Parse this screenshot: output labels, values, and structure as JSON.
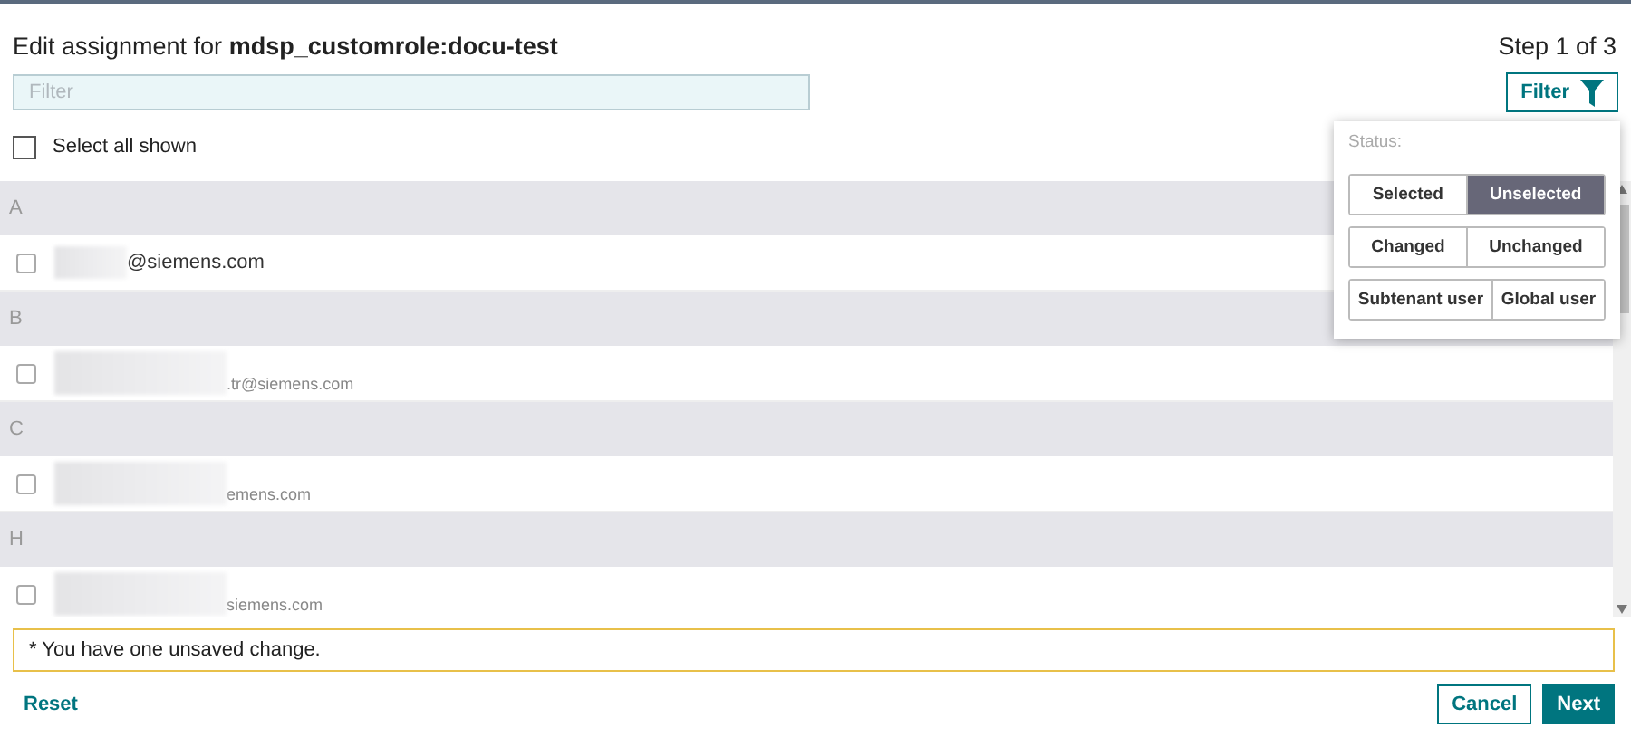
{
  "header": {
    "title_prefix": "Edit assignment for",
    "title_role": "mdsp_customrole:docu-test",
    "step": "Step 1 of 3"
  },
  "filter_field": {
    "placeholder": "Filter"
  },
  "filter_button": {
    "label": "Filter"
  },
  "select_all": {
    "label": "Select all shown",
    "checked": false
  },
  "groups": [
    {
      "letter": "A",
      "rows": [
        {
          "email": "@siemens.com",
          "kind": "primary",
          "checked": false
        }
      ]
    },
    {
      "letter": "B",
      "rows": [
        {
          "email": ".tr@siemens.com",
          "kind": "secondary",
          "checked": false
        }
      ]
    },
    {
      "letter": "C",
      "rows": [
        {
          "email": "emens.com",
          "kind": "secondary",
          "checked": false
        }
      ]
    },
    {
      "letter": "H",
      "rows": [
        {
          "email": "siemens.com",
          "kind": "secondary",
          "checked": false
        }
      ]
    }
  ],
  "filter_popup": {
    "label": "Status:",
    "toggle_groups": [
      [
        {
          "label": "Selected",
          "selected": false
        },
        {
          "label": "Unselected",
          "selected": true
        }
      ],
      [
        {
          "label": "Changed",
          "selected": false
        },
        {
          "label": "Unchanged",
          "selected": false
        }
      ],
      [
        {
          "label": "Subtenant user",
          "selected": false
        },
        {
          "label": "Global user",
          "selected": false
        }
      ]
    ]
  },
  "notice": "* You have one unsaved change.",
  "footer": {
    "reset": "Reset",
    "cancel": "Cancel",
    "next": "Next"
  }
}
